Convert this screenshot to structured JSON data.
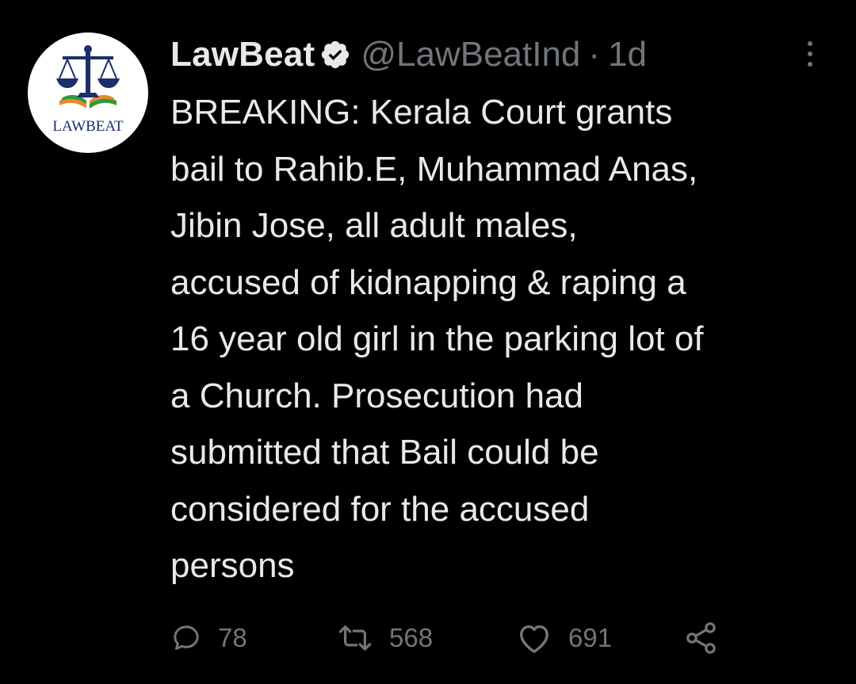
{
  "colors": {
    "background": "#000000",
    "text_primary": "#e7e9ea",
    "text_secondary": "#71767b",
    "avatar_bg": "#ffffff",
    "logo_navy": "#1b2f6b",
    "logo_orange": "#e8892b",
    "logo_green": "#2e9a3e"
  },
  "tweet": {
    "author": {
      "display_name": "LawBeat",
      "handle": "@LawBeatInd",
      "separator": "·",
      "time": "1d",
      "verified_icon": "verified-badge-icon",
      "avatar_logo_text": "LAWBEAT"
    },
    "text": "BREAKING: Kerala Court grants\nbail to Rahib.E, Muhammad Anas,\nJibin Jose, all adult males,\naccused of kidnapping & raping a\n16 year old girl in the parking lot of\na Church. Prosecution had\nsubmitted that Bail could be\nconsidered for the accused\npersons",
    "actions": {
      "reply": {
        "icon": "reply-icon",
        "count": "78"
      },
      "retweet": {
        "icon": "retweet-icon",
        "count": "568"
      },
      "like": {
        "icon": "heart-icon",
        "count": "691"
      },
      "share": {
        "icon": "share-icon"
      }
    },
    "more_icon": "more-options-icon"
  }
}
